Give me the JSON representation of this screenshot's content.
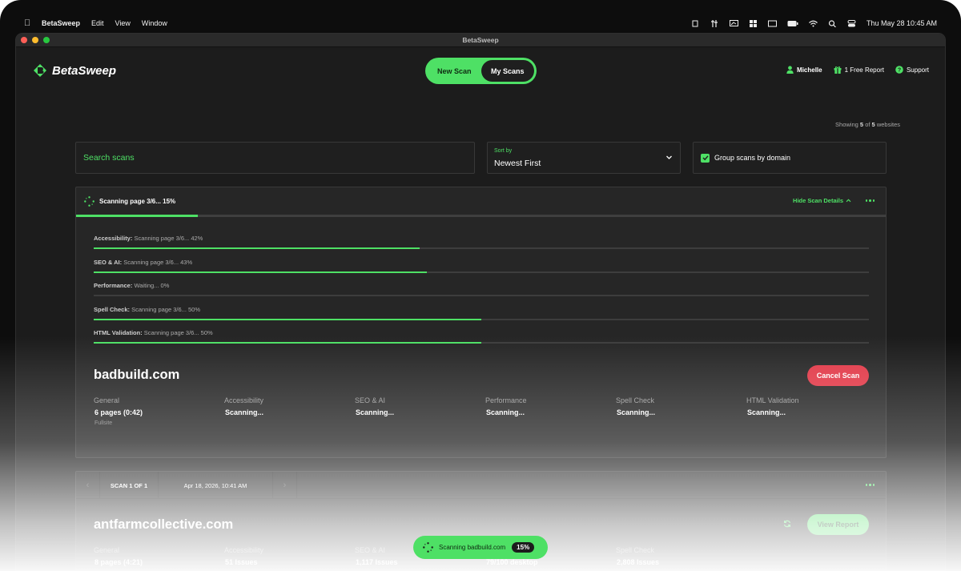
{
  "menubar": {
    "app_name": "BetaSweep",
    "menus": [
      "Edit",
      "View",
      "Window"
    ],
    "datetime": "Thu May 28  10:45 AM"
  },
  "window": {
    "title": "BetaSweep"
  },
  "header": {
    "logo_text": "BetaSweep",
    "toggle": {
      "new_scan": "New Scan",
      "my_scans": "My Scans",
      "active": "My Scans"
    },
    "user": "Michelle",
    "free_report": "1 Free Report",
    "support": "Support"
  },
  "results": {
    "showing_prefix": "Showing",
    "shown": "5",
    "of": "of",
    "total": "5",
    "suffix": "websites"
  },
  "filters": {
    "search_placeholder": "Search scans",
    "sort_label": "Sort by",
    "sort_value": "Newest First",
    "group_label": "Group scans by domain",
    "group_checked": true
  },
  "active_scan": {
    "status": "Scanning page 3/6... 15%",
    "progress": 0.15,
    "hide_details": "Hide Scan Details",
    "steps": [
      {
        "name": "Accessibility:",
        "detail": "Scanning page 3/6... 42%",
        "progress": 0.42
      },
      {
        "name": "SEO & AI:",
        "detail": "Scanning page 3/6... 43%",
        "progress": 0.43
      },
      {
        "name": "Performance:",
        "detail": "Waiting... 0%",
        "progress": 0.0
      },
      {
        "name": "Spell Check:",
        "detail": "Scanning page 3/6... 50%",
        "progress": 0.5
      },
      {
        "name": "HTML Validation:",
        "detail": "Scanning page 3/6... 50%",
        "progress": 0.5
      }
    ],
    "domain": "badbuild.com",
    "cancel": "Cancel Scan",
    "metrics": [
      {
        "label": "General",
        "value": "6 pages (0:42)",
        "sub": "Fullsite"
      },
      {
        "label": "Accessibility",
        "value": "Scanning..."
      },
      {
        "label": "SEO & AI",
        "value": "Scanning..."
      },
      {
        "label": "Performance",
        "value": "Scanning..."
      },
      {
        "label": "Spell Check",
        "value": "Scanning..."
      },
      {
        "label": "HTML Validation",
        "value": "Scanning..."
      }
    ]
  },
  "completed_scan": {
    "scan_counter": "SCAN 1 OF 1",
    "date": "Apr 18, 2026, 10:41 AM",
    "domain": "antfarmcollective.com",
    "view_report": "View Report",
    "metrics": [
      {
        "label": "General",
        "value": "8 pages (4:21)"
      },
      {
        "label": "Accessibility",
        "value": "51 Issues"
      },
      {
        "label": "SEO & AI",
        "value": "1,117 Issues"
      },
      {
        "label": "Performance",
        "value": "79/100 desktop"
      },
      {
        "label": "Spell Check",
        "value": "2,808 Issues"
      }
    ]
  },
  "toast": {
    "text": "Scanning badbuild.com",
    "percent": "15%"
  },
  "colors": {
    "accent": "#4ee065",
    "danger": "#e23a49",
    "background": "#1c1c1c",
    "card": "#262626"
  }
}
